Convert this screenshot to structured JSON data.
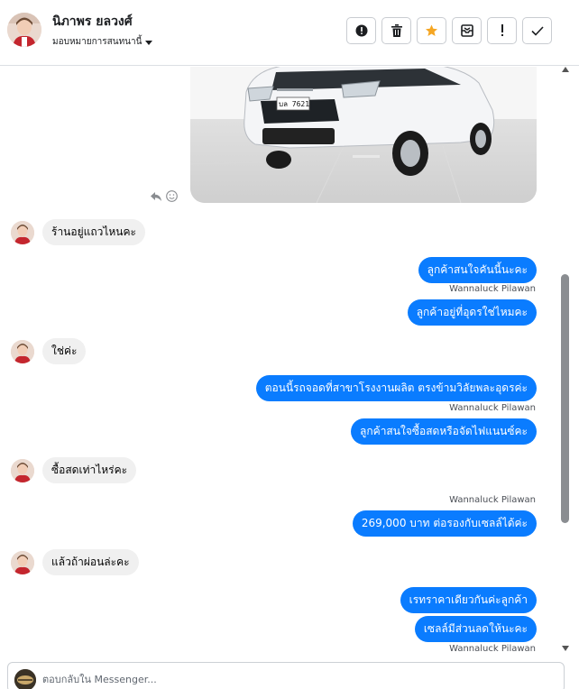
{
  "header": {
    "contact_name": "นิภาพร ยลวงศ์",
    "assign_label": "มอบหมายการสนทนานี้",
    "actions": [
      {
        "icon": "exclamation-circle-icon"
      },
      {
        "icon": "trash-icon"
      },
      {
        "icon": "star-icon",
        "color": "#f5a623"
      },
      {
        "icon": "archive-icon"
      },
      {
        "icon": "exclamation-icon"
      },
      {
        "icon": "check-icon"
      }
    ]
  },
  "colors": {
    "outgoing_bubble": "#0a7cff",
    "incoming_bubble": "#f0f0f0",
    "star": "#f5a623"
  },
  "messages": [
    {
      "dir": "in",
      "text": "ร้านอยู่แถวไหนคะ"
    },
    {
      "dir": "out",
      "text": "ลูกค้าสนใจคันนี้นะคะ"
    },
    {
      "dir": "sender",
      "text": "Wannaluck Pilawan"
    },
    {
      "dir": "out",
      "text": "ลูกค้าอยู่ที่อุดรใช่ไหมคะ"
    },
    {
      "dir": "in",
      "text": "ใช่ค่ะ"
    },
    {
      "dir": "out",
      "text": "ตอนนี้รถจอดที่สาขาโรงงานผลิต  ตรงข้ามวิลัยพละอุดรค่ะ"
    },
    {
      "dir": "sender",
      "text": "Wannaluck Pilawan"
    },
    {
      "dir": "out",
      "text": "ลูกค้าสนใจซื้อสดหรือจัดไฟแนนซ์คะ"
    },
    {
      "dir": "in",
      "text": "ซื้อสดเท่าไหร่คะ"
    },
    {
      "dir": "sender",
      "text": "Wannaluck Pilawan"
    },
    {
      "dir": "out",
      "text": "269,000 บาท  ต่อรองกับเซลล์ได้ค่ะ"
    },
    {
      "dir": "in",
      "text": "แล้วถ้าผ่อนล่ะคะ"
    },
    {
      "dir": "out",
      "text": "เรทราคาเดียวกันค่ะลูกค้า"
    },
    {
      "dir": "out",
      "text": "เซลล์มีส่วนลดให้นะคะ"
    },
    {
      "dir": "sender",
      "text": "Wannaluck Pilawan"
    }
  ],
  "car_photo": {
    "plate_text": "บล 7621"
  },
  "composer": {
    "placeholder": "ตอบกลับใน Messenger..."
  }
}
